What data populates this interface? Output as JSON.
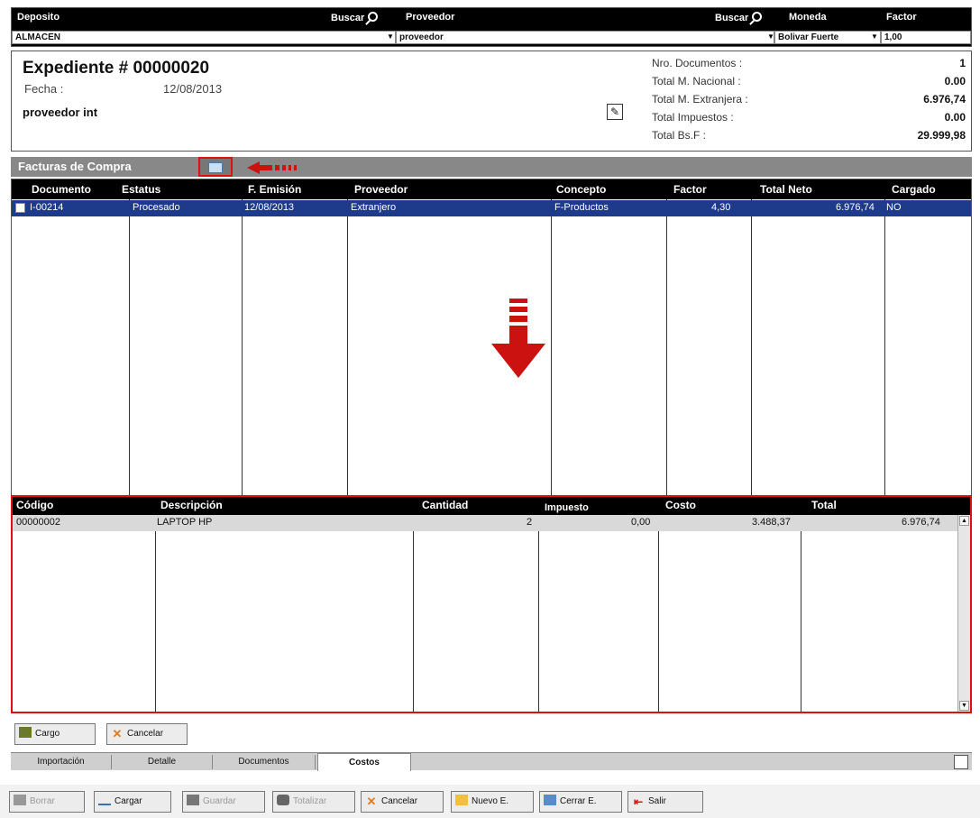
{
  "header": {
    "deposito_label": "Deposito",
    "buscar1_label": "Buscar",
    "proveedor_label": "Proveedor",
    "buscar2_label": "Buscar",
    "moneda_label": "Moneda",
    "factor_label": "Factor",
    "deposito_value": "ALMACEN",
    "proveedor_value": "proveedor",
    "moneda_value": "Bolivar Fuerte",
    "factor_value": "1,00"
  },
  "info": {
    "title": "Expediente # 00000020",
    "fecha_label": "Fecha :",
    "fecha_value": "12/08/2013",
    "proveedor": "proveedor int",
    "totals": [
      {
        "label": "Nro. Documentos :",
        "value": "1"
      },
      {
        "label": "Total M. Nacional :",
        "value": "0.00"
      },
      {
        "label": "Total M. Extranjera :",
        "value": "6.976,74"
      },
      {
        "label": "Total Impuestos :",
        "value": "0.00"
      },
      {
        "label": "Total Bs.F :",
        "value": "29.999,98"
      }
    ]
  },
  "facturas": {
    "title": "Facturas de Compra",
    "columns": [
      "Documento",
      "Estatus",
      "F. Emisión",
      "Proveedor",
      "Concepto",
      "Factor",
      "Total Neto",
      "Cargado"
    ],
    "rows": [
      [
        "I-00214",
        "Procesado",
        "12/08/2013",
        "Extranjero",
        "F-Productos",
        "4,30",
        "6.976,74",
        "NO"
      ]
    ]
  },
  "detalle": {
    "columns": [
      "Código",
      "Descripción",
      "Cantidad",
      "Impuesto",
      "Costo",
      "Total"
    ],
    "rows": [
      [
        "00000002",
        "LAPTOP HP",
        "2",
        "0,00",
        "3.488,37",
        "6.976,74"
      ]
    ]
  },
  "actions": {
    "cargo": "Cargo",
    "cancelar": "Cancelar"
  },
  "tabs": [
    "Importación",
    "Detalle",
    "Documentos",
    "Costos"
  ],
  "toolbar": [
    "Borrar",
    "Cargar",
    "Guardar",
    "Totalizar",
    "Cancelar",
    "Nuevo E.",
    "Cerrar E.",
    "Salir"
  ]
}
